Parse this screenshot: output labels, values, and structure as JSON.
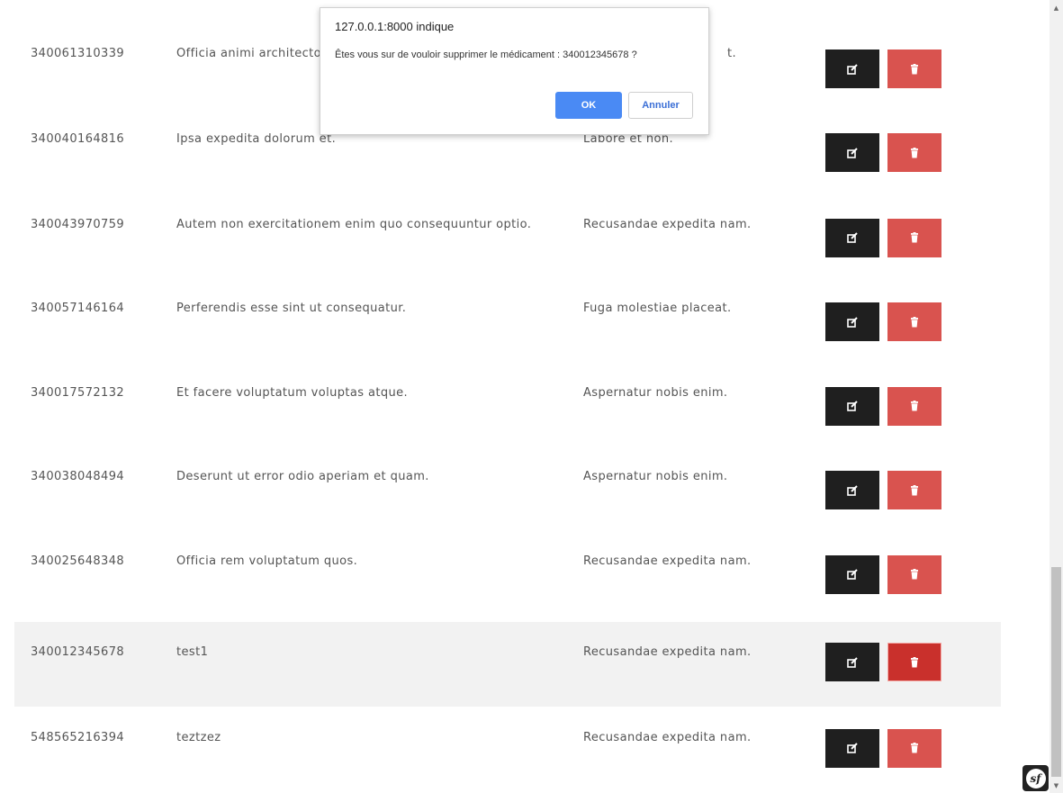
{
  "dialog": {
    "title": "127.0.0.1:8000 indique",
    "message": "Êtes vous sur de vouloir supprimer le médicament : 340012345678 ?",
    "ok_label": "OK",
    "cancel_label": "Annuler"
  },
  "table": {
    "rows": [
      {
        "code": "340061310339",
        "name": "Officia animi architecto",
        "desc": "t."
      },
      {
        "code": "340040164816",
        "name": "Ipsa expedita dolorum et.",
        "desc": "Labore et non."
      },
      {
        "code": "340043970759",
        "name": "Autem non exercitationem enim quo consequuntur optio.",
        "desc": "Recusandae expedita nam."
      },
      {
        "code": "340057146164",
        "name": "Perferendis esse sint ut consequatur.",
        "desc": "Fuga molestiae placeat."
      },
      {
        "code": "340017572132",
        "name": "Et facere voluptatum voluptas atque.",
        "desc": "Aspernatur nobis enim."
      },
      {
        "code": "340038048494",
        "name": "Deserunt ut error odio aperiam et quam.",
        "desc": "Aspernatur nobis enim."
      },
      {
        "code": "340025648348",
        "name": "Officia rem voluptatum quos.",
        "desc": "Recusandae expedita nam."
      },
      {
        "code": "340012345678",
        "name": "test1",
        "desc": "Recusandae expedita nam."
      },
      {
        "code": "548565216394",
        "name": "teztzez",
        "desc": "Recusandae expedita nam."
      }
    ]
  },
  "icons": {
    "edit": "edit-icon",
    "delete": "trash-icon",
    "symfony": "symfony-logo-icon"
  },
  "colors": {
    "edit_button": "#1f1f1f",
    "delete_button": "#d9534f",
    "delete_button_active": "#c9302c",
    "ok_button": "#4a8af4",
    "highlight_row": "#f2f2f2"
  }
}
